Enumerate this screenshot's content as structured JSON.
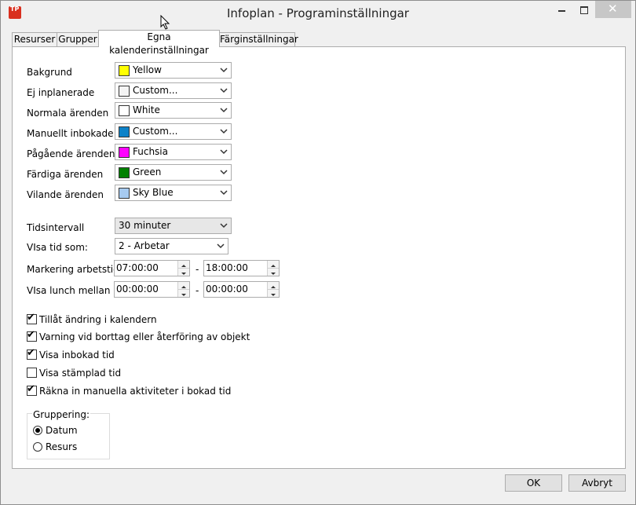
{
  "window": {
    "title": "Infoplan - Programinställningar",
    "icon_text": "TP",
    "minimize_icon": "minimize-icon",
    "maximize_icon": "maximize-icon",
    "close_icon": "close-icon",
    "close_glyph": "✕"
  },
  "tabs": [
    {
      "label": "Resurser",
      "active": false
    },
    {
      "label": "Grupper",
      "active": false
    },
    {
      "label": "Egna kalenderinställningar",
      "active": true
    },
    {
      "label": "Färginställningar",
      "active": false
    }
  ],
  "colors": {
    "rows": [
      {
        "label": "Bakgrund",
        "value": "Yellow",
        "swatch": "#ffff00"
      },
      {
        "label": "Ej inplanerade",
        "value": "Custom...",
        "swatch": "#f4f4f4"
      },
      {
        "label": "Normala ärenden",
        "value": "White",
        "swatch": "#ffffff"
      },
      {
        "label": "Manuellt inbokade",
        "value": "Custom...",
        "swatch": "#0d82c8"
      },
      {
        "label": "Pågående ärenden",
        "value": "Fuchsia",
        "swatch": "#ff00ff"
      },
      {
        "label": "Färdiga ärenden",
        "value": "Green",
        "swatch": "#008000"
      },
      {
        "label": "Vilande ärenden",
        "value": "Sky Blue",
        "swatch": "#a6caf0"
      }
    ]
  },
  "time": {
    "interval_label": "Tidsintervall",
    "interval_value": "30 minuter",
    "show_label": "VIsa tid som:",
    "show_value": "2 - Arbetar",
    "work_label": "Markering arbetstid",
    "work_from": "07:00:00",
    "work_to": "18:00:00",
    "lunch_label": "VIsa lunch mellan",
    "lunch_from": "00:00:00",
    "lunch_to": "00:00:00",
    "dash": "-"
  },
  "checkboxes": [
    {
      "label": "Tillåt ändring i kalendern",
      "checked": true
    },
    {
      "label": "Varning vid borttag eller återföring av objekt",
      "checked": true
    },
    {
      "label": "Visa inbokad tid",
      "checked": true
    },
    {
      "label": "Visa stämplad tid",
      "checked": false
    },
    {
      "label": "Räkna in manuella aktiviteter i bokad tid",
      "checked": true
    }
  ],
  "grouping": {
    "title": "Gruppering:",
    "options": [
      {
        "label": "Datum",
        "selected": true
      },
      {
        "label": "Resurs",
        "selected": false
      }
    ]
  },
  "buttons": {
    "ok": "OK",
    "cancel": "Avbryt"
  }
}
